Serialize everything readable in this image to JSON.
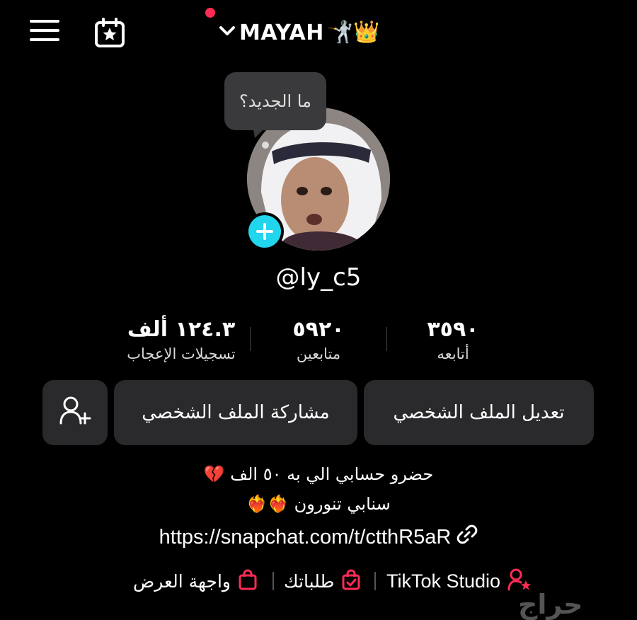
{
  "header": {
    "account_name": "MAYAH",
    "name_emojis": "🤺👑",
    "icons": [
      "menu-icon",
      "calendar-star-icon",
      "chevron-down-icon"
    ]
  },
  "profile": {
    "bubble_text": "ما الجديد؟",
    "username": "@ly_c5"
  },
  "stats": [
    {
      "value": "٣٥٩٠",
      "label": "أتابعه"
    },
    {
      "value": "٥٩٢٠",
      "label": "متابعين"
    },
    {
      "value": "١٢٤.٣ ألف",
      "label": "تسجيلات الإعجاب"
    }
  ],
  "actions": {
    "edit_profile": "تعديل الملف الشخصي",
    "share_profile": "مشاركة الملف الشخصي"
  },
  "bio": {
    "line1": "حضرو حسابي الي به ٥٠ الف 💔",
    "line2": "سنابي تنورون ❤️‍🔥❤️‍🔥",
    "link": "https://snapchat.com/t/ctthR5aR"
  },
  "bottom": {
    "studio": "TikTok Studio",
    "orders": "طلباتك",
    "showcase": "واجهة العرض"
  },
  "watermark": "حراج",
  "colors": {
    "background": "#000000",
    "notification": "#fe2c55",
    "accent_cyan": "#20d5ec",
    "button_bg": "#2a2a2c",
    "pink_icon": "#fe2c55"
  }
}
